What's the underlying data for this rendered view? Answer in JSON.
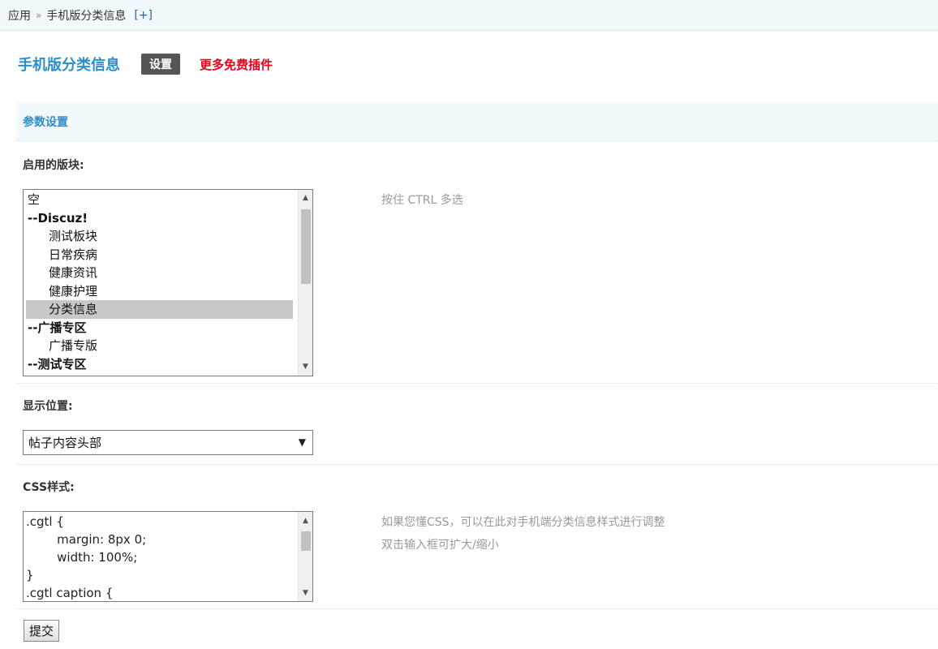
{
  "breadcrumb": {
    "root": "应用",
    "separator": "»",
    "current": "手机版分类信息",
    "add_link": "[+]"
  },
  "header": {
    "title": "手机版分类信息",
    "settings_button": "设置",
    "more_link": "更多免费插件"
  },
  "section": {
    "title": "参数设置"
  },
  "forums_field": {
    "label": "启用的版块:",
    "hint": "按住 CTRL 多选",
    "options": [
      {
        "label": "空",
        "kind": "empty",
        "selected": false
      },
      {
        "label": "--Discuz!",
        "kind": "group",
        "selected": false
      },
      {
        "label": "测试板块",
        "kind": "child",
        "selected": false
      },
      {
        "label": "日常疾病",
        "kind": "child",
        "selected": false
      },
      {
        "label": "健康资讯",
        "kind": "child",
        "selected": false
      },
      {
        "label": "健康护理",
        "kind": "child",
        "selected": false
      },
      {
        "label": "分类信息",
        "kind": "child",
        "selected": true
      },
      {
        "label": "--广播专区",
        "kind": "group",
        "selected": false
      },
      {
        "label": "广播专版",
        "kind": "child",
        "selected": false
      },
      {
        "label": "--测试专区",
        "kind": "group",
        "selected": false
      }
    ]
  },
  "position_field": {
    "label": "显示位置:",
    "selected": "帖子内容头部"
  },
  "css_field": {
    "label": "CSS样式:",
    "value": ".cgtl {\n        margin: 8px 0;\n        width: 100%;\n}\n.cgtl caption {",
    "hint_line1": "如果您懂CSS，可以在此对手机端分类信息样式进行调整",
    "hint_line2": "双击输入框可扩大/缩小"
  },
  "submit_button": "提交",
  "colors": {
    "accent": "#2b8fc8",
    "more_link": "#e8001c",
    "settings_bg": "#555555",
    "bar_bg": "#f2f9fd"
  }
}
